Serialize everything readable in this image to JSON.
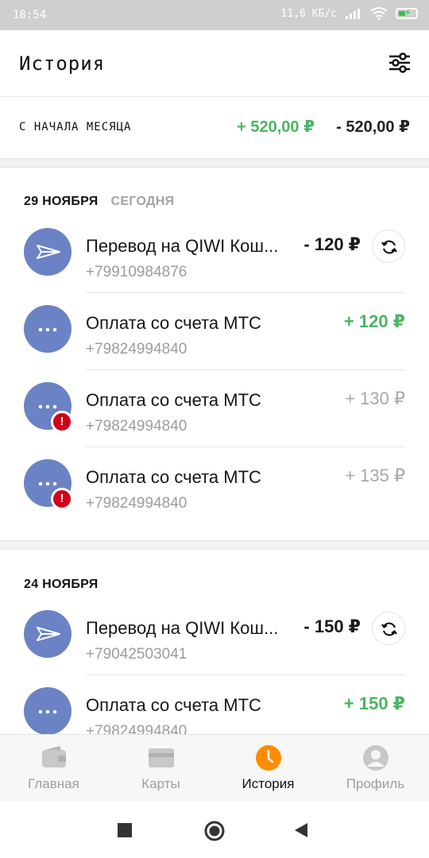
{
  "status_bar": {
    "time": "18:54",
    "speed": "11,6 КБ/с"
  },
  "header": {
    "title": "История"
  },
  "summary": {
    "label": "С НАЧАЛА МЕСЯЦА",
    "income": "+ 520,00 ₽",
    "expense": "- 520,00 ₽"
  },
  "groups": [
    {
      "date": "29 НОЯБРЯ",
      "sub": "СЕГОДНЯ",
      "transactions": [
        {
          "title": "Перевод на QIWI Кош...",
          "phone": "+79910984876",
          "amount": "- 120 ₽",
          "kind": "transfer",
          "status": "negative",
          "repeat": true
        },
        {
          "title": "Оплата со счета МТС",
          "phone": "+79824994840",
          "amount": "+ 120 ₽",
          "kind": "payment",
          "status": "positive",
          "repeat": false
        },
        {
          "title": "Оплата со счета МТС",
          "phone": "+79824994840",
          "amount": "+ 130 ₽",
          "kind": "payment",
          "status": "failed",
          "repeat": false
        },
        {
          "title": "Оплата со счета МТС",
          "phone": "+79824994840",
          "amount": "+ 135 ₽",
          "kind": "payment",
          "status": "failed",
          "repeat": false
        }
      ]
    },
    {
      "date": "24 НОЯБРЯ",
      "sub": "",
      "transactions": [
        {
          "title": "Перевод на QIWI Кош...",
          "phone": "+79042503041",
          "amount": "- 150 ₽",
          "kind": "transfer",
          "status": "negative",
          "repeat": true
        },
        {
          "title": "Оплата со счета МТС",
          "phone": "+79824994840",
          "amount": "+ 150 ₽",
          "kind": "payment",
          "status": "positive",
          "repeat": false
        }
      ]
    }
  ],
  "alert_glyph": "!",
  "bottom_nav": [
    {
      "label": "Главная",
      "icon": "wallet-icon",
      "active": false
    },
    {
      "label": "Карты",
      "icon": "card-icon",
      "active": false
    },
    {
      "label": "История",
      "icon": "clock-icon",
      "active": true
    },
    {
      "label": "Профиль",
      "icon": "profile-icon",
      "active": false
    }
  ],
  "colors": {
    "positive": "#4cb562",
    "accent": "#ff8c00",
    "avatar": "#6b82c5",
    "alert": "#d0021b"
  }
}
